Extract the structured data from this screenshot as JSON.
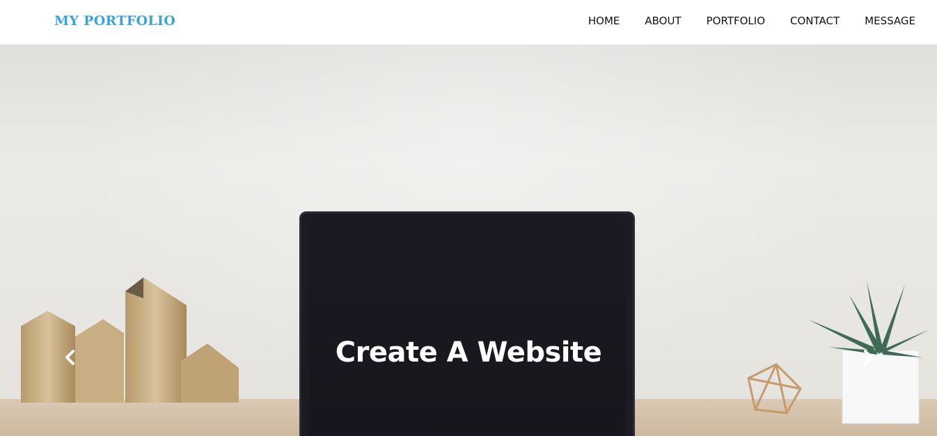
{
  "navbar": {
    "brand": "MY PORTFOLIO",
    "links": [
      "HOME",
      "ABOUT",
      "PORTFOLIO",
      "CONTACT",
      "MESSAGE"
    ]
  },
  "hero": {
    "caption": "Create A Website",
    "prev_icon": "chevron-left-icon",
    "next_icon": "chevron-right-icon"
  },
  "colors": {
    "brand": "#3aa3df",
    "nav_text": "#111111",
    "caption": "#ffffff"
  }
}
